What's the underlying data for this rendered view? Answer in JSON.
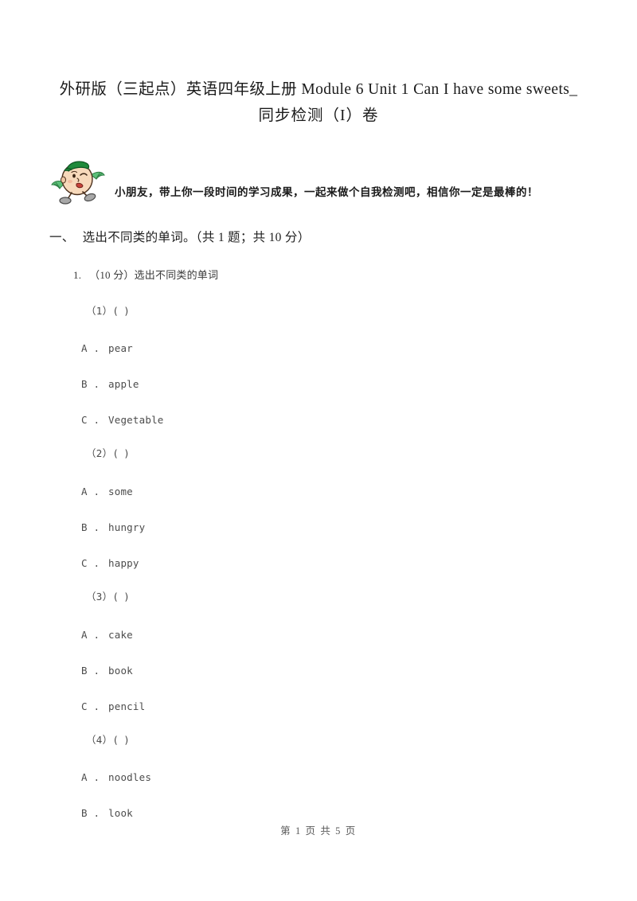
{
  "document": {
    "title_line1": "外研版（三起点）英语四年级上册 Module 6 Unit 1 Can I have some sweets_",
    "title_line2": "同步检测（I）卷",
    "intro_text": "小朋友，带上你一段时间的学习成果，一起来做个自我检测吧，相信你一定是最棒的！",
    "mascot_icon": "cartoon-mascot-icon"
  },
  "section": {
    "index_label": "一、",
    "title": "选出不同类的单词。（共 1 题；共 10 分）"
  },
  "question": {
    "number": "1.",
    "stem": "（10 分）选出不同类的单词",
    "subquestions": [
      {
        "label": "（1）(",
        "blank_close": ")",
        "options": [
          {
            "letter": "A .",
            "text": "pear"
          },
          {
            "letter": "B .",
            "text": "apple"
          },
          {
            "letter": "C .",
            "text": "Vegetable"
          }
        ]
      },
      {
        "label": "（2）(",
        "blank_close": ")",
        "options": [
          {
            "letter": "A .",
            "text": "some"
          },
          {
            "letter": "B .",
            "text": "hungry"
          },
          {
            "letter": "C .",
            "text": "happy"
          }
        ]
      },
      {
        "label": "（3）(",
        "blank_close": ")",
        "options": [
          {
            "letter": "A .",
            "text": "cake"
          },
          {
            "letter": "B .",
            "text": "book"
          },
          {
            "letter": "C .",
            "text": "pencil"
          }
        ]
      },
      {
        "label": "（4）(",
        "blank_close": ")",
        "options": [
          {
            "letter": "A .",
            "text": "noodles"
          },
          {
            "letter": "B .",
            "text": "look"
          }
        ]
      }
    ]
  },
  "footer": {
    "page_label": "第 1 页 共 5 页"
  },
  "colors": {
    "page_background": "#ffffff",
    "title_text": "#1a1a1a",
    "body_text": "#4c4c4c",
    "footer_text": "#5a5a5a",
    "mascot_cap": "#1f8a3b",
    "mascot_skin": "#f3d0b0",
    "mascot_wing": "#3fa35c",
    "mascot_shoe": "#9a9a9a"
  }
}
